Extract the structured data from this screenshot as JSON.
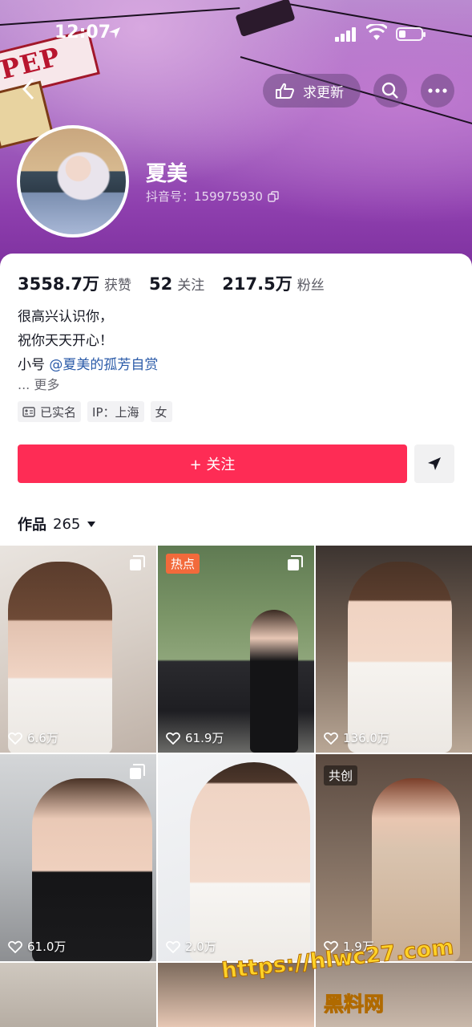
{
  "status_bar": {
    "time": "12:07",
    "battery_level": 0.3
  },
  "header": {
    "update_button_label": "求更新",
    "profile_name": "夏美",
    "douyin_id": "抖音号：159975930"
  },
  "stats": [
    {
      "value": "3558.7万",
      "label": "获赞"
    },
    {
      "value": "52",
      "label": "关注"
    },
    {
      "value": "217.5万",
      "label": "粉丝"
    }
  ],
  "bio": {
    "line1": "很高兴认识你，",
    "line2": "祝你天天开心！",
    "line3_prefix": "小号 ",
    "line3_mention": "@夏美的孤芳自赏",
    "more": "...  更多"
  },
  "tags": [
    "已实名",
    "IP：上海",
    "女"
  ],
  "follow_button_label": "+ 关注",
  "works": {
    "label": "作品",
    "count": "265"
  },
  "videos": [
    {
      "likes": "6.6万",
      "badge": "",
      "multi": true
    },
    {
      "likes": "61.9万",
      "badge": "热点",
      "multi": true
    },
    {
      "likes": "136.0万",
      "badge": "",
      "multi": false
    },
    {
      "likes": "61.0万",
      "badge": "",
      "multi": true
    },
    {
      "likes": "2.0万",
      "badge": "",
      "multi": false
    },
    {
      "likes": "1.9万",
      "badge": "共创",
      "multi": false
    }
  ],
  "watermark": {
    "url": "https://hlwc27.com",
    "name": "黑料网"
  },
  "colors": {
    "accent": "#fe2c55",
    "mention": "#2a5aa8",
    "hot_badge": "#f26a3b"
  }
}
